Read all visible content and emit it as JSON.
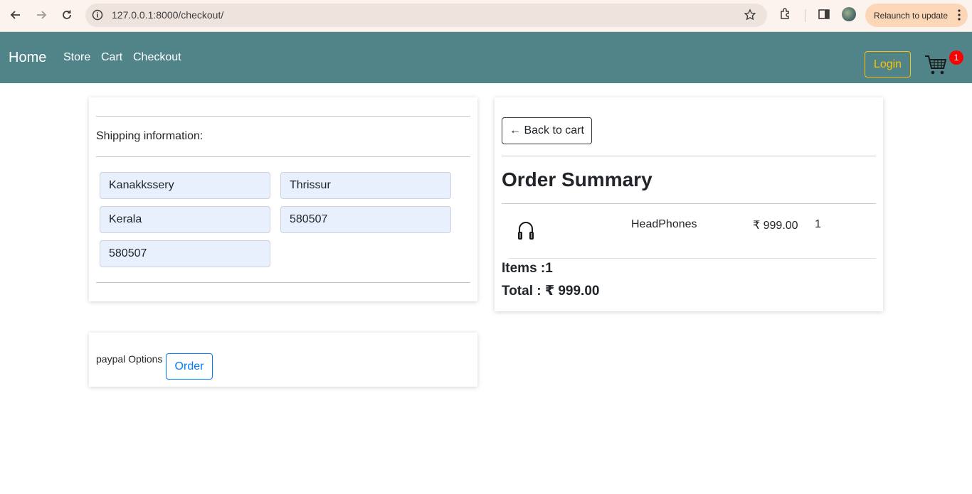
{
  "browser": {
    "url": "127.0.0.1:8000/checkout/",
    "relaunch_label": "Relaunch to update"
  },
  "navbar": {
    "brand": "Home",
    "links": [
      "Store",
      "Cart",
      "Checkout"
    ],
    "login_label": "Login",
    "cart_count": "1"
  },
  "shipping": {
    "heading": "Shipping information:",
    "fields": {
      "address": "Kanakkssery",
      "city": "Thrissur",
      "state": "Kerala",
      "zipcode": "580507",
      "extra": "580507"
    }
  },
  "payment": {
    "label": "paypal Options",
    "order_button": "Order"
  },
  "summary": {
    "back_button": "← Back to cart",
    "title": "Order Summary",
    "items": [
      {
        "icon": "headphones-icon",
        "name": "HeadPhones",
        "price": "₹ 999.00",
        "qty": "1"
      }
    ],
    "items_label": "Items :1",
    "total_label": "Total : ₹ 999.00"
  },
  "colors": {
    "navbar": "#508488",
    "accent_login": "#ffc107",
    "primary": "#007bff",
    "badge": "#ff0000"
  }
}
